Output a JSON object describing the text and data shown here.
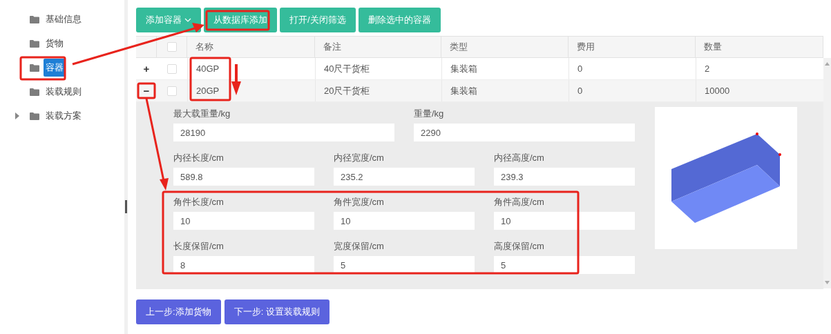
{
  "sidebar": {
    "items": [
      {
        "label": "基础信息",
        "selected": false,
        "has_children": false
      },
      {
        "label": "货物",
        "selected": false,
        "has_children": false
      },
      {
        "label": "容器",
        "selected": true,
        "has_children": false
      },
      {
        "label": "装载规则",
        "selected": false,
        "has_children": false
      },
      {
        "label": "装载方案",
        "selected": false,
        "has_children": true
      }
    ]
  },
  "toolbar": {
    "buttons": [
      {
        "label": "添加容器",
        "dropdown": true
      },
      {
        "label": "从数据库添加",
        "dropdown": false
      },
      {
        "label": "打开/关闭筛选",
        "dropdown": false
      },
      {
        "label": "删除选中的容器",
        "dropdown": false
      }
    ]
  },
  "table": {
    "header_checked": false,
    "columns": [
      "名称",
      "备注",
      "类型",
      "费用",
      "数量"
    ],
    "rows": [
      {
        "expanded": false,
        "checked": false,
        "cells": [
          "40GP",
          "40尺干货柜",
          "集装箱",
          "0",
          "2"
        ]
      },
      {
        "expanded": true,
        "checked": false,
        "cells": [
          "20GP",
          "20尺干货柜",
          "集装箱",
          "0",
          "10000"
        ]
      }
    ],
    "expand_signs": {
      "collapsed": "+",
      "expanded": "−"
    },
    "detail": {
      "field_rows": [
        {
          "fields": [
            {
              "label": "最大载重量/kg",
              "value": "28190"
            },
            {
              "label": "重量/kg",
              "value": "2290"
            }
          ]
        },
        {
          "fields": [
            {
              "label": "内径长度/cm",
              "value": "589.8"
            },
            {
              "label": "内径宽度/cm",
              "value": "235.2"
            },
            {
              "label": "内径高度/cm",
              "value": "239.3"
            }
          ]
        },
        {
          "fields": [
            {
              "label": "角件长度/cm",
              "value": "10"
            },
            {
              "label": "角件宽度/cm",
              "value": "10"
            },
            {
              "label": "角件高度/cm",
              "value": "10"
            }
          ]
        },
        {
          "fields": [
            {
              "label": "长度保留/cm",
              "value": "8"
            },
            {
              "label": "宽度保留/cm",
              "value": "5"
            },
            {
              "label": "高度保留/cm",
              "value": "5"
            }
          ]
        }
      ]
    }
  },
  "footer": {
    "buttons": [
      "上一步:添加货物",
      "下一步: 设置装载规则"
    ]
  }
}
